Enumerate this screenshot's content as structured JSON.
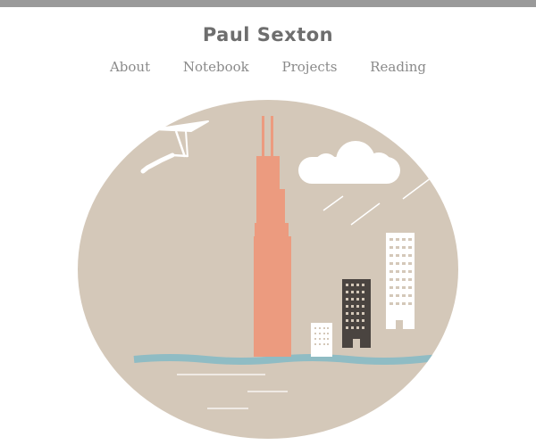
{
  "header": {
    "site_title": "Paul Sexton"
  },
  "nav": {
    "items": [
      {
        "label": "About"
      },
      {
        "label": "Notebook"
      },
      {
        "label": "Projects"
      },
      {
        "label": "Reading"
      }
    ]
  },
  "hero": {
    "icons": [
      "hang-glider-icon",
      "cloud-icon",
      "skyscraper-icon",
      "building-icon",
      "lake-icon"
    ],
    "colors": {
      "sky_circle": "#d4c8b9",
      "tower": "#ec9b7f",
      "dark_building": "#4a4440",
      "white": "#ffffff",
      "water": "#8fbcc4",
      "top_bar": "#9a9a9a",
      "text": "#6e6e6e"
    }
  }
}
